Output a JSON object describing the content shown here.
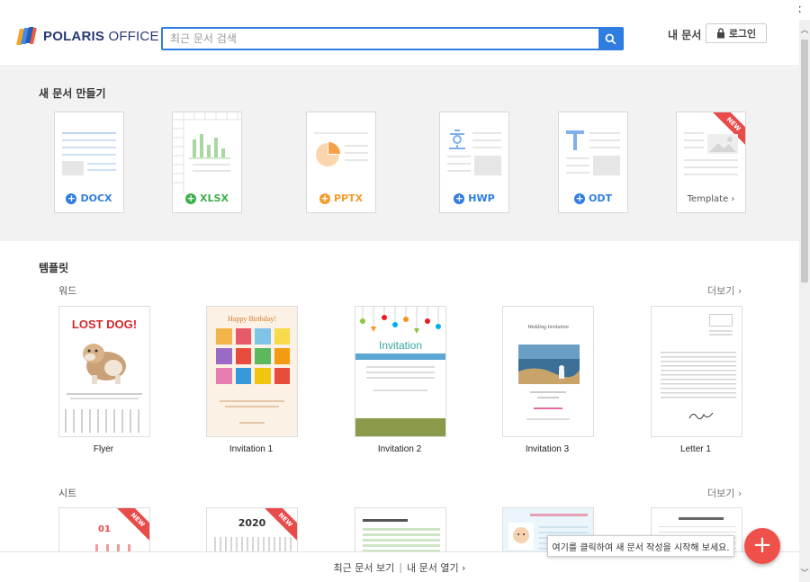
{
  "window": {
    "help": "?",
    "minimize": "_",
    "restore": "❐",
    "close": "✕"
  },
  "header": {
    "brand_bold": "POLARIS",
    "brand_light": " OFFICE",
    "search_placeholder": "최근 문서 검색",
    "my_docs": "내 문서",
    "login": "로그인"
  },
  "new_doc": {
    "title": "새 문서 만들기",
    "items": [
      {
        "label": "DOCX",
        "color": "#2f7de1"
      },
      {
        "label": "XLSX",
        "color": "#3cae4a"
      },
      {
        "label": "PPTX",
        "color": "#f49b2c"
      },
      {
        "label": "HWP",
        "color": "#2f7de1"
      },
      {
        "label": "ODT",
        "color": "#2f7de1"
      },
      {
        "label": "Template ›",
        "badge": "NEW"
      }
    ]
  },
  "templates": {
    "title": "템플릿",
    "word": {
      "label": "워드",
      "more": "더보기 ›",
      "items": [
        {
          "name": "Flyer",
          "headline": "LOST DOG!"
        },
        {
          "name": "Invitation 1",
          "headline": "Happy Birthday!"
        },
        {
          "name": "Invitation 2",
          "headline": "Invitation"
        },
        {
          "name": "Invitation 3",
          "headline": "Wedding Invitation"
        },
        {
          "name": "Letter 1"
        }
      ]
    },
    "sheet": {
      "label": "시트",
      "more": "더보기 ›",
      "items": [
        {
          "headline": "01",
          "badge": "NEW"
        },
        {
          "headline": "2020",
          "badge": "NEW"
        },
        {},
        {},
        {}
      ]
    }
  },
  "bottom": {
    "recent": "최근 문서 보기",
    "separator": "|",
    "open": "내 문서 열기 ›"
  },
  "tooltip": "여기를 클릭하여 새 문서 작성을 시작해 보세요.",
  "fab": "+"
}
